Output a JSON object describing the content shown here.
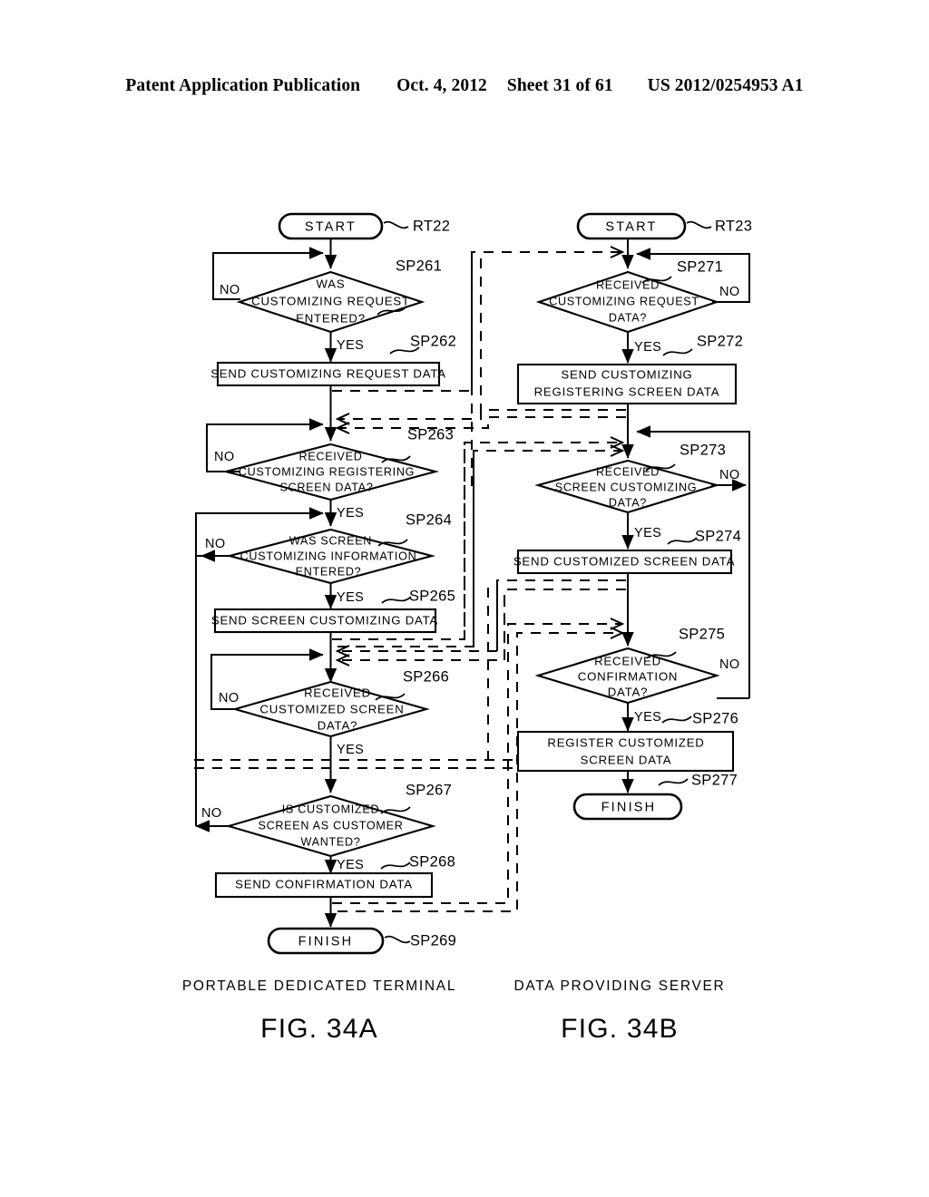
{
  "header": {
    "publication": "Patent Application Publication",
    "date": "Oct. 4, 2012",
    "sheet": "Sheet 31 of 61",
    "patent_number": "US 2012/0254953 A1"
  },
  "figures": [
    {
      "id": "fig-34a",
      "caption": "FIG. 34A",
      "subtitle": "PORTABLE DEDICATED TERMINAL",
      "routine_ref": "RT22"
    },
    {
      "id": "fig-34b",
      "caption": "FIG. 34B",
      "subtitle": "DATA PROVIDING SERVER",
      "routine_ref": "RT23"
    }
  ],
  "terminals": {
    "start": "START",
    "finish": "FINISH"
  },
  "branches": {
    "yes": "YES",
    "no": "NO"
  },
  "left_flow": {
    "start_label": "START",
    "start_ref": "RT22",
    "steps": [
      {
        "ref": "SP261",
        "kind": "decision",
        "lines": [
          "WAS",
          "CUSTOMIZING REQUEST",
          "ENTERED?"
        ],
        "yes": "YES",
        "no": "NO"
      },
      {
        "ref": "SP262",
        "kind": "process",
        "lines": [
          "SEND CUSTOMIZING REQUEST DATA"
        ]
      },
      {
        "ref": "SP263",
        "kind": "decision",
        "lines": [
          "RECEIVED",
          "CUSTOMIZING REGISTERING",
          "SCREEN DATA?"
        ],
        "yes": "YES",
        "no": "NO"
      },
      {
        "ref": "SP264",
        "kind": "decision",
        "lines": [
          "WAS SCREEN",
          "CUSTOMIZING INFORMATION",
          "ENTERED?"
        ],
        "yes": "YES",
        "no": "NO"
      },
      {
        "ref": "SP265",
        "kind": "process",
        "lines": [
          "SEND SCREEN CUSTOMIZING DATA"
        ]
      },
      {
        "ref": "SP266",
        "kind": "decision",
        "lines": [
          "RECEIVED",
          "CUSTOMIZED SCREEN",
          "DATA?"
        ],
        "yes": "YES",
        "no": "NO"
      },
      {
        "ref": "SP267",
        "kind": "decision",
        "lines": [
          "IS CUSTOMIZED",
          "SCREEN AS CUSTOMER",
          "WANTED?"
        ],
        "yes": "YES",
        "no": "NO"
      },
      {
        "ref": "SP268",
        "kind": "process",
        "lines": [
          "SEND CONFIRMATION DATA"
        ]
      },
      {
        "ref": "SP269",
        "kind": "terminal",
        "lines": [
          "FINISH"
        ]
      }
    ]
  },
  "right_flow": {
    "start_label": "START",
    "start_ref": "RT23",
    "steps": [
      {
        "ref": "SP271",
        "kind": "decision",
        "lines": [
          "RECEIVED",
          "CUSTOMIZING REQUEST",
          "DATA?"
        ],
        "yes": "YES",
        "no": "NO"
      },
      {
        "ref": "SP272",
        "kind": "process",
        "lines": [
          "SEND CUSTOMIZING",
          "REGISTERING SCREEN DATA"
        ]
      },
      {
        "ref": "SP273",
        "kind": "decision",
        "lines": [
          "RECEIVED",
          "SCREEN CUSTOMIZING",
          "DATA?"
        ],
        "yes": "YES",
        "no": "NO"
      },
      {
        "ref": "SP274",
        "kind": "process",
        "lines": [
          "SEND CUSTOMIZED SCREEN DATA"
        ]
      },
      {
        "ref": "SP275",
        "kind": "decision",
        "lines": [
          "RECEIVED",
          "CONFIRMATION",
          "DATA?"
        ],
        "yes": "YES",
        "no": "NO"
      },
      {
        "ref": "SP276",
        "kind": "process",
        "lines": [
          "REGISTER CUSTOMIZED",
          "SCREEN DATA"
        ]
      },
      {
        "ref": "SP277",
        "kind": "terminal",
        "lines": [
          "FINISH"
        ]
      }
    ]
  }
}
